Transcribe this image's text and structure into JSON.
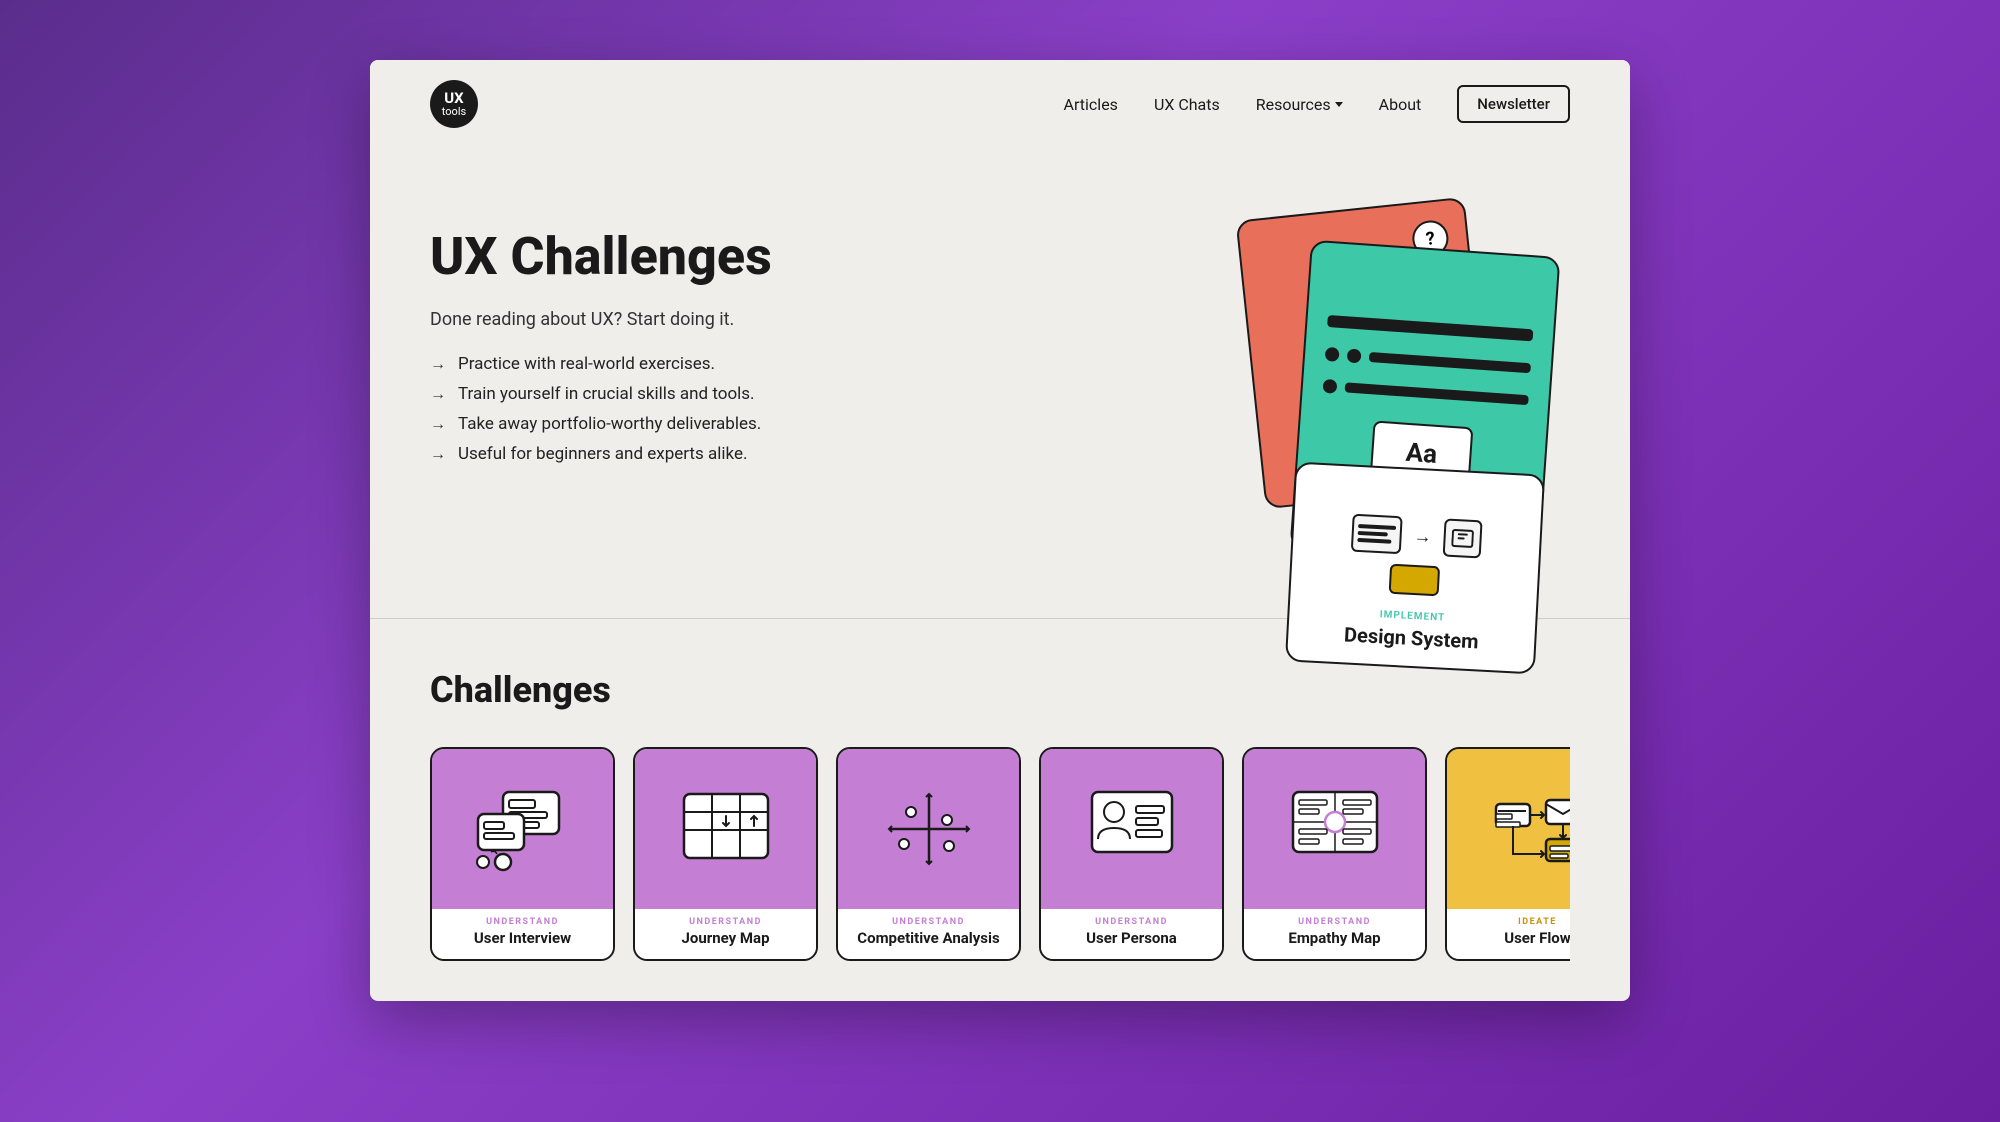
{
  "nav": {
    "logo_line1": "UX",
    "logo_line2": "tools",
    "links": [
      {
        "label": "Articles",
        "id": "articles"
      },
      {
        "label": "UX Chats",
        "id": "ux-chats"
      },
      {
        "label": "Resources",
        "id": "resources",
        "has_dropdown": true
      },
      {
        "label": "About",
        "id": "about"
      }
    ],
    "cta_label": "Newsletter"
  },
  "hero": {
    "title": "UX Challenges",
    "subtitle": "Done reading about UX? Start doing it.",
    "bullets": [
      "Practice with real-world exercises.",
      "Train yourself in crucial skills and tools.",
      "Take away portfolio-worthy deliverables.",
      "Useful for beginners and experts alike."
    ],
    "illustration": {
      "card_back_label": "?",
      "card_front_label": "Aa",
      "card_third_category": "IMPLEMENT",
      "card_third_title": "Design System"
    }
  },
  "challenges": {
    "section_title": "Challenges",
    "cards": [
      {
        "id": "user-interview",
        "category": "UNDERSTAND",
        "name": "User Interview",
        "color": "purple"
      },
      {
        "id": "journey-map",
        "category": "UNDERSTAND",
        "name": "Journey Map",
        "color": "purple"
      },
      {
        "id": "competitive-analysis",
        "category": "UNDERSTAND",
        "name": "Competitive Analysis",
        "color": "purple"
      },
      {
        "id": "user-persona",
        "category": "UNDERSTAND",
        "name": "User Persona",
        "color": "purple"
      },
      {
        "id": "empathy-map",
        "category": "UNDERSTAND",
        "name": "Empathy Map",
        "color": "purple"
      },
      {
        "id": "user-flow",
        "category": "IDEATE",
        "name": "User Flow",
        "color": "yellow"
      }
    ]
  }
}
